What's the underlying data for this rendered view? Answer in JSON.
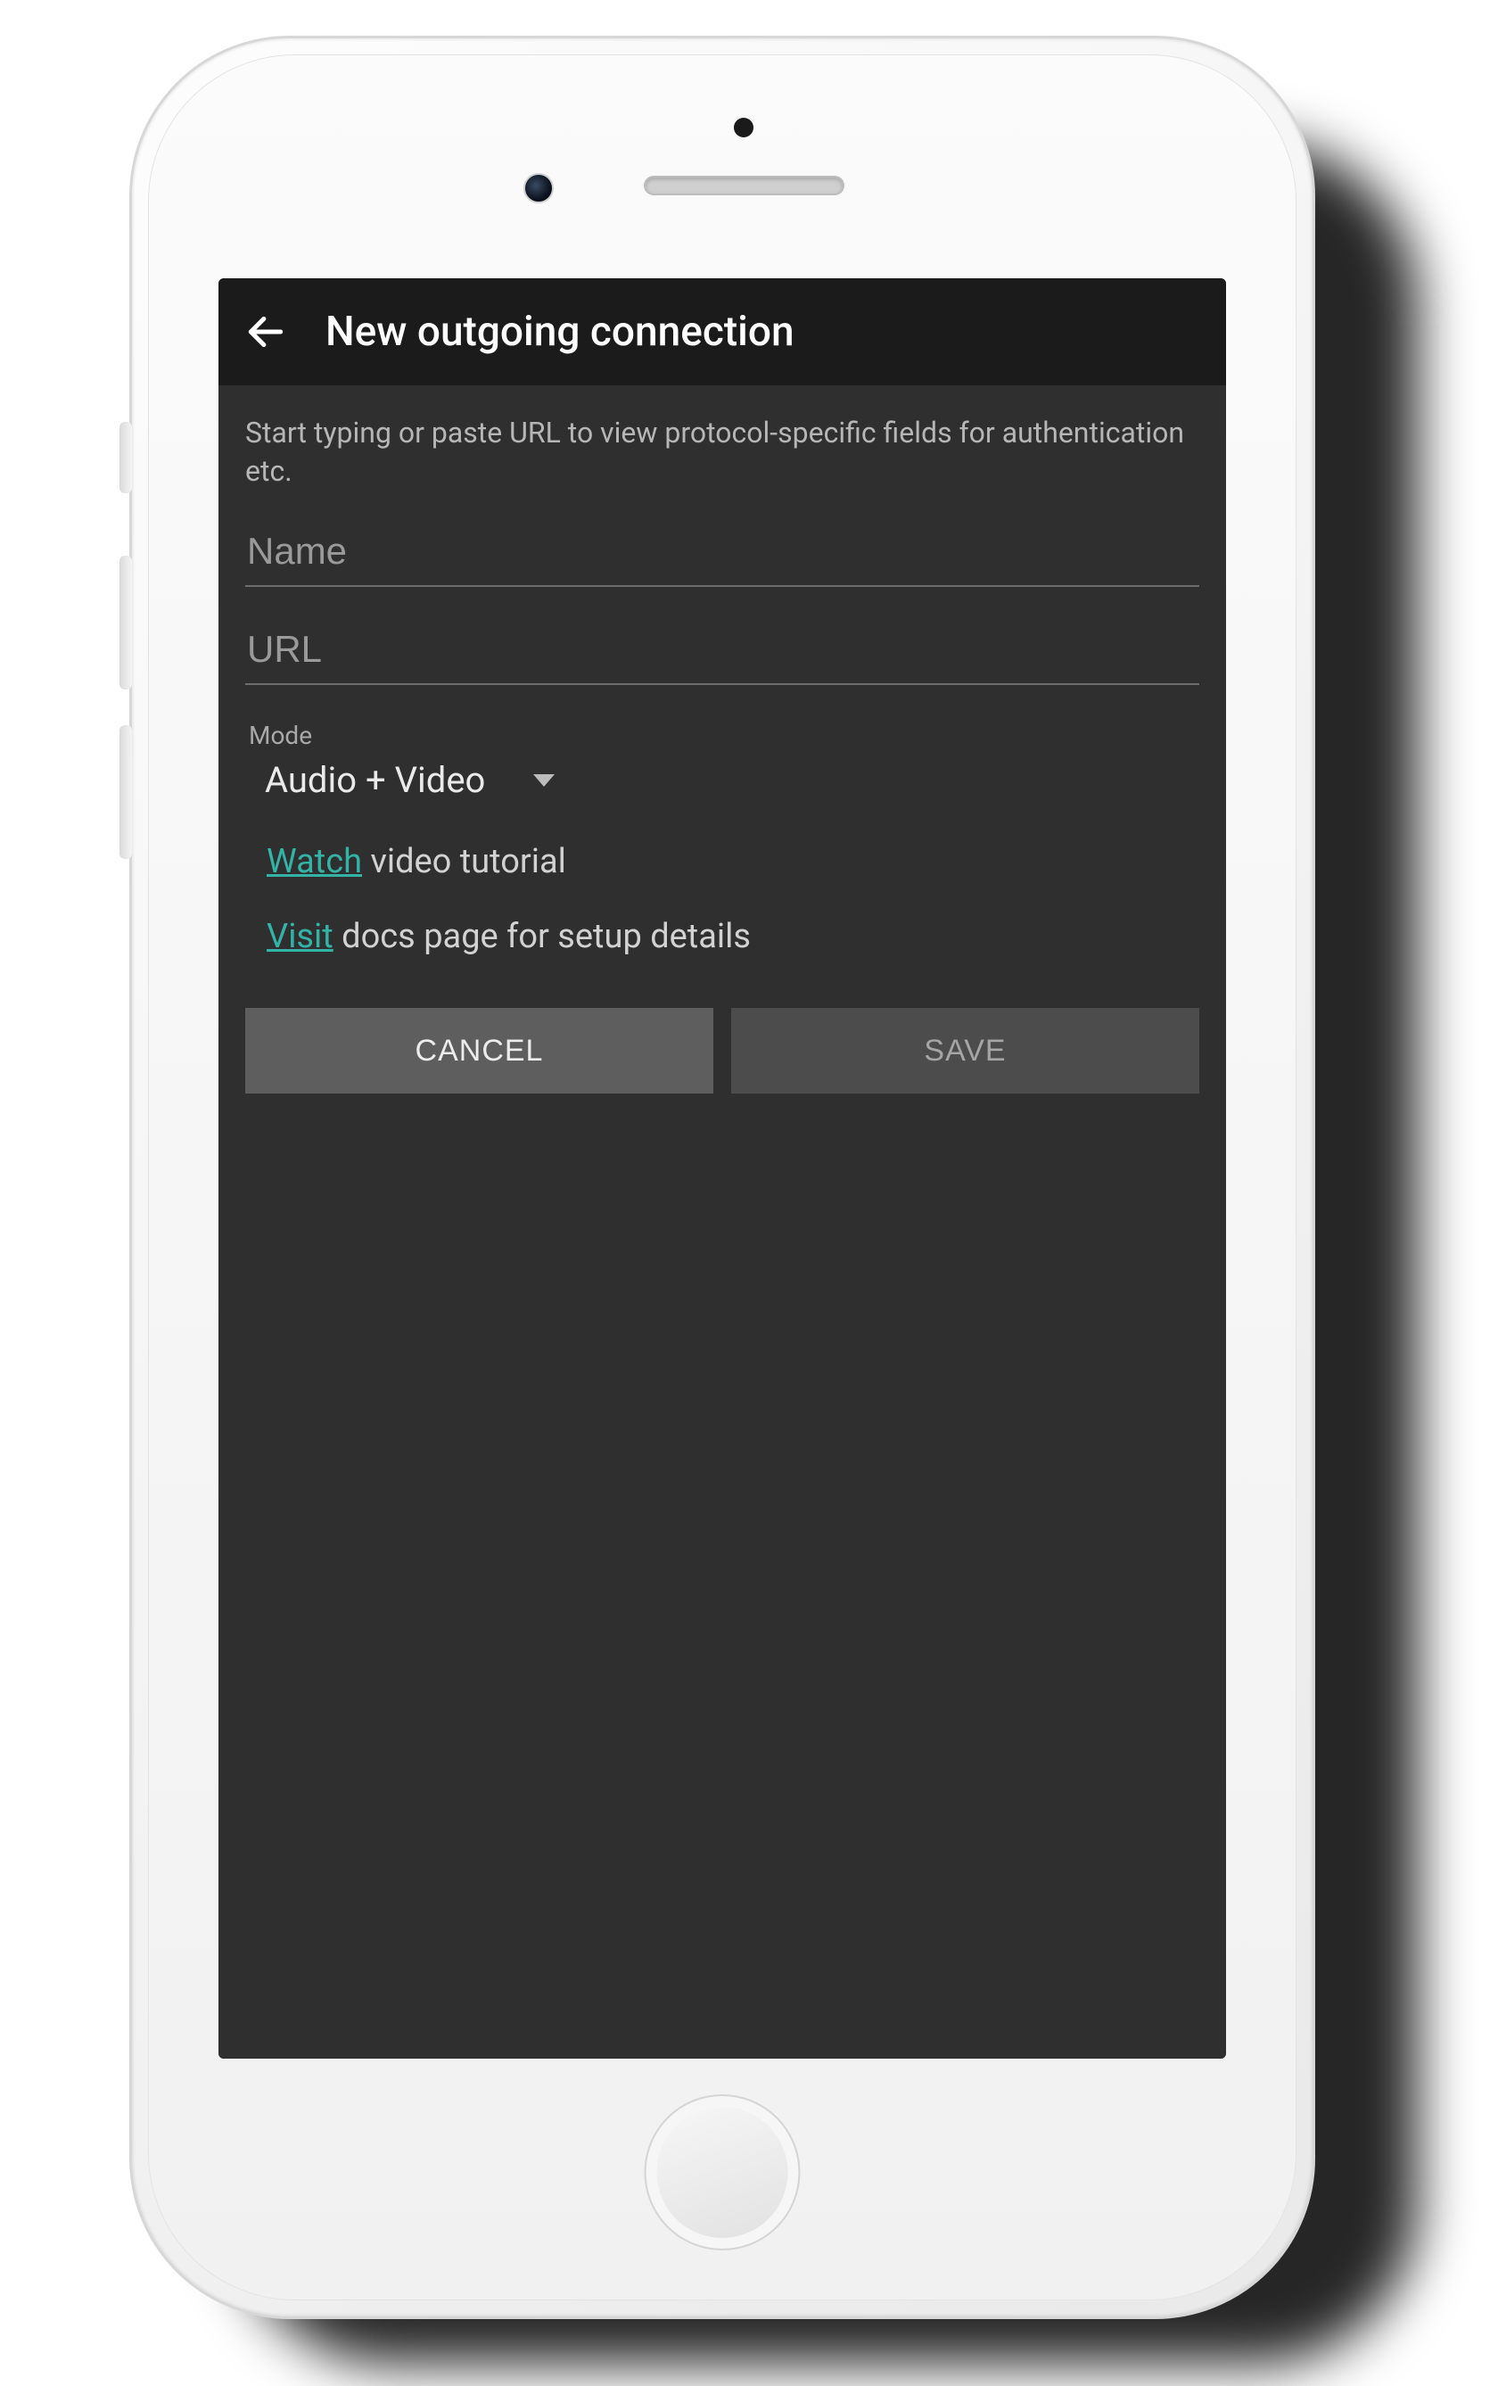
{
  "header": {
    "title": "New outgoing connection"
  },
  "hint": "Start typing or paste URL to view protocol-specific fields for authentication etc.",
  "fields": {
    "name": {
      "placeholder": "Name",
      "value": ""
    },
    "url": {
      "placeholder": "URL",
      "value": ""
    }
  },
  "mode": {
    "label": "Mode",
    "selected": "Audio + Video"
  },
  "links": {
    "watch": {
      "link": "Watch",
      "rest": " video tutorial"
    },
    "visit": {
      "link": "Visit",
      "rest": " docs page for setup details"
    }
  },
  "buttons": {
    "cancel": "CANCEL",
    "save": "SAVE"
  },
  "colors": {
    "accent": "#33b3a6",
    "appbar": "#1b1b1b",
    "background": "#2f2f2f"
  }
}
